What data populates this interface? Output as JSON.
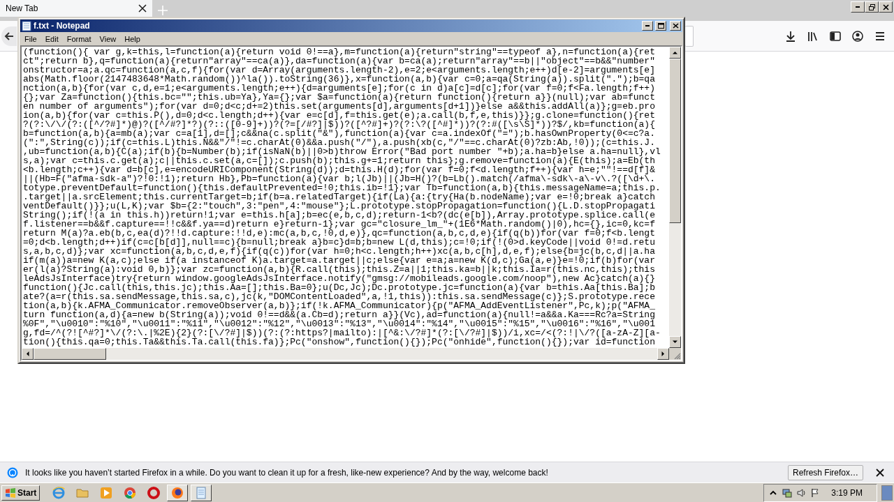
{
  "browser": {
    "tabs": [
      {
        "label": "New Tab",
        "selected": true
      }
    ],
    "notification": {
      "message": "It looks like you haven’t started Firefox in a while. Do you want to clean it up for a fresh, like-new experience? And by the way, welcome back!",
      "button": "Refresh Firefox…"
    }
  },
  "notepad": {
    "title": "f.txt - Notepad",
    "menu": [
      "File",
      "Edit",
      "Format",
      "View",
      "Help"
    ],
    "lines": [
      "(function(){ var g,k=this,l=function(a){return void 0!==a},m=function(a){return\"string\"==typeof a},n=function(a){ret",
      "ct\";return b},q=function(a){return\"array\"==ca(a)},da=function(a){var b=ca(a);return\"array\"==b||\"object\"==b&&\"number\"",
      "onstructor=a;a.qc=function(a,c,f){for(var d=Array(arguments.length-2),e=2;e<arguments.length;e++)d[e-2]=arguments[e]",
      "abs(Math.floor(2147483648*Math.random())^la()).toString(36)},x=function(a,b){var c=0;a=qa(String(a)).split(\".\");b=qa",
      "nction(a,b){for(var c,d,e=1;e<arguments.length;e++){d=arguments[e];for(c in d)a[c]=d[c];for(var f=0;f<Fa.length;f++)",
      "{};var Za=function(){this.bc=\"\";this.ub=Ya},Ya={};var $a=function(a){return function(){return a}}(null);var ab=funct",
      "en number of arguments\");for(var d=0;d<c;d+=2)this.set(arguments[d],arguments[d+1])}else a&&this.addAll(a)};g=eb.pro",
      "ion(a,b){for(var c=this.P(),d=0;d<c.length;d++){var e=c[d],f=this.get(e);a.call(b,f,e,this)}};g.clone=function(){ret",
      "?(?:\\/\\/(?:([^/?#]*)@)?([^/#?]*?)(?::([0-9]+))?(?=[/#?]|$))?([^?#]+)?(?:\\?([^#]*))?(?:#([\\s\\S]*))?$/,kb=function(a){",
      "b=function(a,b){a=mb(a);var c=a[1],d=[];c&&na(c.split(\"&\"),function(a){var c=a.indexOf(\"=\");b.hasOwnProperty(0<=c?a.",
      "(\":\",String(c));if(c=this.L)this.N&&\"/\"!=c.charAt(0)&&a.push(\"/\"),a.push(xb(c,\"/\"==c.charAt(0)?zb:Ab,!0));(c=this.J.",
      ",ub=function(a,b){C(a);if(b){b=Number(b);if(isNaN(b)||0>b)throw Error(\"Bad port number \"+b);a.ha=b}else a.ha=null},vl",
      "s,a);var c=this.c.get(a);c||this.c.set(a,c=[]);c.push(b);this.g+=1;return this};g.remove=function(a){E(this);a=Eb(th",
      "<b.length;c++){var d=b[c],e=encodeURIComponent(String(d));d=this.H(d);for(var f=0;f<d.length;f++){var h=e;\"\"!==d[f]&",
      "||(Hb=F(\"afma-sdk-a\")?!0:!1);return Hb},Pb=function(a){var b;l(Jb)||(Jb=H()?(b=Lb().match(/afma\\-sdk\\-a\\-v\\.?([\\d+\\.",
      "totype.preventDefault=function(){this.defaultPrevented=!0;this.ib=!1};var Tb=function(a,b){this.messageName=a;this.p.",
      ".target||a.srcElement;this.currentTarget=b;if(b=a.relatedTarget){if(La){a:{try{Ha(b.nodeName);var e=!0;break a}catch",
      "ventDefault()}};u(L,K);var $b={2:\"touch\",3:\"pen\",4:\"mouse\"};L.prototype.stopPropagation=function(){L.D.stopPropagati",
      "String();if(!(a in this.h))return!1;var e=this.h[a];b=ec(e,b,c,d);return-1<b?(dc(e[b]),Array.prototype.splice.call(e",
      "f.listener==b&&f.capture==!!c&&f.ya==d)return e}return-1};var gc=\"closure_lm_\"+(1E6*Math.random()|0),hc={},ic=0,kc=f",
      "return M(a)?a.eb(b,c,ea(d)?!!d.capture:!!d,e):mc(a,b,c,!0,d,e)},qc=function(a,b,c,d,e){if(q(b))for(var f=0;f<b.lengt",
      "=0;d<b.length;d++)if(c=c[b[d]],null==c){b=null;break a}b=c}d=b;b=new L(d,this);c=!0;if(!(0>d.keyCode||void 0!=d.retu",
      "s,a,b,c,d)};var xc=function(a,b,c,d,e,f){if(q(c))for(var h=0;h<c.length;h++)xc(a,b,c[h],d,e,f);else{b=jc(b,c,d||a.ha",
      "if(m(a))a=new K(a,c);else if(a instanceof K)a.target=a.target||c;else{var e=a;a=new K(d,c);Ga(a,e)}e=!0;if(b)for(var",
      "er(l(a)?String(a):void 0,b)};var zc=function(a,b){R.call(this);this.Z=a||1;this.ka=b||k;this.Ia=r(this.nc,this);this",
      "leAdsJsInterface)try{return window.googleAdsJsInterface.notify(\"gmsg://mobileads.google.com/noop\"),new Ac}catch(a){}",
      "function(){Jc.call(this,this.jc);this.Aa=[];this.Ba=0};u(Dc,Jc);Dc.prototype.jc=function(a){var b=this.Aa[this.Ba];b",
      "ate?(a=r(this.sa.sendMessage,this.sa,c),jc(k,\"DOMContentLoaded\",a,!1,this)):this.sa.sendMessage(c)};S.prototype.rece",
      "tion(a,b){k.AFMA_Communicator.removeObserver(a,b)};if(!k.AFMA_Communicator){p(\"AFMA_AddEventListener\",Pc,k);p(\"AFMA_",
      "turn function(a,d){a=new b(String(a));void 0!==d&&(a.Cb=d);return a}}(Vc),ad=function(a){null!=a&&a.Ka===Rc?a=String",
      "%0F\",\"\\u0010\":\"%10\",\"\\u0011\":\"%11\",\"\\u0012\":\"%12\",\"\\u0013\":\"%13\",\"\\u0014\":\"%14\",\"\\u0015\":\"%15\",\"\\u0016\":\"%16\",\"\\u001",
      "g,fd=/^(?![^#?]*\\/(?:\\.|%2E){2}(?:[\\/?#]|$))(?:(?:https?|mailto):|[^&:\\/?#]*(?:[\\/?#]|$))/i,xc=/<(?:!|\\/?([a-zA-Z][a-",
      "tion(){this.qa=0;this.Ta&&this.Ta.call(this.fa)};Pc(\"onshow\",function(){});Pc(\"onhide\",function(){});var id=function"
    ]
  },
  "taskbar": {
    "start": "Start",
    "apps": [
      {
        "kind": "ie",
        "running": false
      },
      {
        "kind": "folder",
        "running": false
      },
      {
        "kind": "media",
        "running": false
      },
      {
        "kind": "chrome",
        "running": false
      },
      {
        "kind": "opera",
        "running": false
      },
      {
        "kind": "firefox",
        "running": true
      },
      {
        "kind": "notepad",
        "running": true
      }
    ],
    "clock": "3:19 PM"
  }
}
